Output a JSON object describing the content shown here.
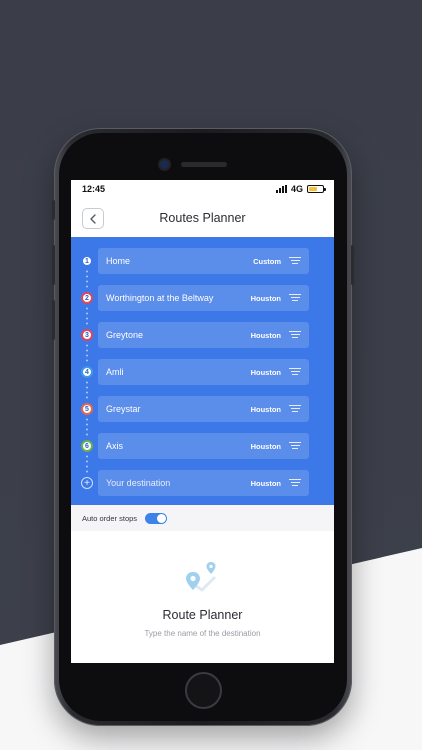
{
  "colors": {
    "accent": "#3c78e8",
    "battery": "#f4c430",
    "toggle": "#3c82e8",
    "icon_light": "#9fd0ee"
  },
  "status_bar": {
    "time": "12:45",
    "network": "4G"
  },
  "nav": {
    "title": "Routes Planner",
    "back_icon": "chevron-left-icon"
  },
  "stops": [
    {
      "marker": "1",
      "name": "Home",
      "city": "Custom",
      "ring": "#3c78e8"
    },
    {
      "marker": "2",
      "name": "Worthington at the Beltway",
      "city": "Houston",
      "ring": "#e0475a"
    },
    {
      "marker": "3",
      "name": "Greytone",
      "city": "Houston",
      "ring": "#e0475a"
    },
    {
      "marker": "4",
      "name": "Amli",
      "city": "Houston",
      "ring": "#3c9ae8"
    },
    {
      "marker": "5",
      "name": "Greystar",
      "city": "Houston",
      "ring": "#e8664a"
    },
    {
      "marker": "6",
      "name": "Axis",
      "city": "Houston",
      "ring": "#6ab04c"
    }
  ],
  "destination": {
    "marker": "+",
    "placeholder": "Your destination",
    "city": "Houston"
  },
  "auto_order": {
    "label": "Auto order stops",
    "enabled": true
  },
  "empty_state": {
    "icon": "route-map-icon",
    "title": "Route Planner",
    "subtitle": "Type the name of the destination"
  }
}
